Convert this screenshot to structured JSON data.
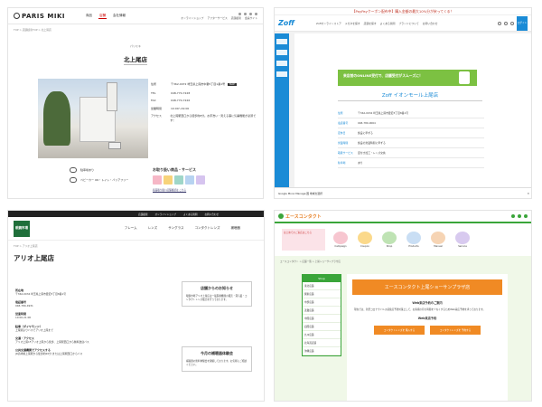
{
  "p1": {
    "logo": "PARIS MIKI",
    "nav": [
      "商品",
      "店舗",
      "会社情報"
    ],
    "util_links": [
      "オンラインショップ",
      "アフターサービス",
      "店舗検索",
      "会員サイト"
    ],
    "breadcrumb": "TOP > 店舗検索TOP > 北上尾店",
    "ruby": "パリミキ",
    "title": "北上尾店",
    "info": [
      {
        "k": "住所",
        "v": "〒362-0072 埼玉県上尾市中妻5丁目1番1号"
      },
      {
        "k": "TEL",
        "v": "048-770-7228"
      },
      {
        "k": "FAX",
        "v": "048-770-7226"
      },
      {
        "k": "営業時間",
        "v": "10:00～19:00"
      },
      {
        "k": "アクセス",
        "v": "北上尾駅西口から徒歩約8分。お手洗い・見える事に気兼機能が必須です！"
      }
    ],
    "map_label": "MAP",
    "parking": [
      "駐車場あり",
      "ベビーカー OK・トイレ・バリアフリー"
    ],
    "services_title": "お取り扱い商品・サービス",
    "services_note": "商品取り扱い店舗確認は こちら"
  },
  "p2": {
    "topbar": "【PayPayクーポン配布中】購入金額の最大10%分が戻ってくる！",
    "logo": "Zoff",
    "nav": [
      "Zoffオンラインストア",
      "メガネを探す",
      "店舗を探す",
      "よくある質問",
      "ブランドについて",
      "お問い合わせ"
    ],
    "member_btn": "ログイン",
    "banner": "来店前のONLINE受付で、店舗受付がスムーズに！",
    "store": "Zoff イオンモール上尾店",
    "rows": [
      {
        "k": "住所",
        "v": "〒362-0034 埼玉県上尾市愛宕3丁目8番1号"
      },
      {
        "k": "電話番号",
        "v": "048-780-9064"
      },
      {
        "k": "定休日",
        "v": "施設に準ずる"
      },
      {
        "k": "営業時間",
        "v": "施設の営業時間に準ずる"
      },
      {
        "k": "取扱サービス",
        "v": "度付き加工・レンズ交換"
      },
      {
        "k": "駐車場",
        "v": "あり"
      }
    ],
    "bottom_bar": "Google  Mono Manage:国  地域を選択"
  },
  "p3": {
    "topbar": [
      "店舗検索",
      "オンラインショップ",
      "よくある質問",
      "お問い合わせ"
    ],
    "logo": "眼鏡市場",
    "nav": [
      "フレーム",
      "レンズ",
      "サングラス",
      "コンタクトレンズ",
      "補聴器"
    ],
    "breadcrumb": "TOP > アリオ上尾店",
    "title": "アリオ上尾店",
    "blocks": [
      {
        "k": "所在地",
        "v": "〒362-0034 埼玉県上尾市愛宕3丁目8番1号"
      },
      {
        "k": "電話番号",
        "v": "048-780-4931"
      },
      {
        "k": "営業時間",
        "v": "10:00-21:00"
      },
      {
        "k": "駐車（ダイヤモンド）",
        "v": "上尾駅よりバスでアリオ上尾まで"
      },
      {
        "k": "交通・アクセス",
        "v": "アリオ上尾1Fアリオ上尾から徒歩、上尾駅西口から無料送迎バス"
      },
      {
        "k": "公共交通機関でアクセスする",
        "v": "JR高崎線上尾駅から徒歩約20分 または上尾駅西口からバス"
      }
    ],
    "card1_title": "店舗からのお知らせ",
    "card1_text": "眼鏡市場アリオ上尾店は一般医療機器の販売・貸与業・コンタクトレンズ販売を行っております。",
    "card2_title": "今月の補聴器体験会",
    "card2_text": "補聴器の無料体験会を開催しております。お気軽にご相談ください。"
  },
  "p4": {
    "logo": "エースコンタクト",
    "promo": "はじめてのご来店はこちら",
    "menu": [
      "Campaign",
      "Coupon",
      "Shop",
      "Products",
      "Manual",
      "Service"
    ],
    "breadcrumb": "エースコンタクト > 店舗一覧 > 上尾ショーサンプラザ店",
    "side_title": "Shop",
    "side_items": [
      "東北店舗",
      "関東店舗",
      "中部店舗",
      "近畿店舗",
      "中国店舗",
      "四国店舗",
      "九州店舗",
      "北海道店舗",
      "沖縄店舗"
    ],
    "title": "エースコンタクト上尾ショーサンプラザ店",
    "notice_title": "Web来店予約のご案内",
    "notice_text": "現在では、新型コロナウイルス感染症予防対策として、お客様の待ち時間を少なくするためWeb来店予約を承っております。",
    "reserve_title": "Web来店予約",
    "buttons": [
      "コンタクトレンズを 購入する",
      "コンタクトレンズを 予約する"
    ]
  }
}
